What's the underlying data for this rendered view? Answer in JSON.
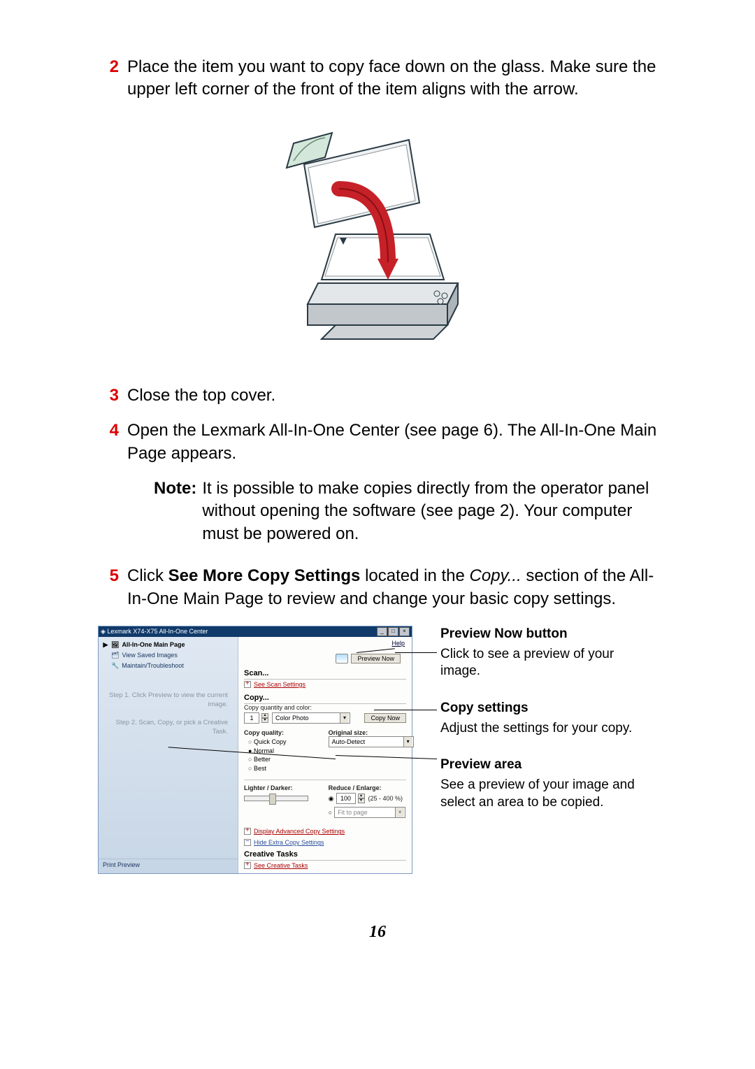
{
  "steps": {
    "s2": {
      "num": "2",
      "text": "Place the item you want to copy face down on the glass. Make sure the upper left corner of the front of the item aligns with the arrow."
    },
    "s3": {
      "num": "3",
      "text": "Close the top cover."
    },
    "s4": {
      "num": "4",
      "text": "Open the Lexmark All-In-One Center (see page 6). The All-In-One Main Page appears."
    },
    "s5": {
      "num": "5",
      "pre": "Click ",
      "bold": "See More Copy Settings",
      "mid": " located in the ",
      "italic": "Copy...",
      "post": " section of the All-In-One Main Page to review and change your basic copy settings."
    }
  },
  "note": {
    "label": "Note:",
    "text": "It is possible to make copies directly from the operator panel without opening the software (see page 2). Your computer must be powered on."
  },
  "callouts": {
    "preview_now": {
      "title": "Preview Now button",
      "text": "Click to see a preview of your image."
    },
    "copy_settings": {
      "title": "Copy settings",
      "text": "Adjust the settings for your copy."
    },
    "preview_area": {
      "title": "Preview area",
      "text": "See a preview of your image and select an area to be copied."
    }
  },
  "window": {
    "title": "Lexmark X74-X75 All-In-One Center",
    "help": "Help",
    "sidebar": {
      "main_page": "All-In-One Main Page",
      "saved": "View Saved Images",
      "maintain": "Maintain/Troubleshoot",
      "step1": "Step 1.  Click Preview to view the current image.",
      "step2": "Step 2.  Scan, Copy, or pick a Creative Task.",
      "footer": "Print Preview"
    },
    "preview_now_btn": "Preview Now",
    "scan": {
      "title": "Scan...",
      "link": "See Scan Settings"
    },
    "copy": {
      "title": "Copy...",
      "sub": "Copy quantity and color:",
      "qty": "1",
      "type": "Color Photo",
      "copy_now_btn": "Copy Now",
      "quality_label": "Copy quality:",
      "quality_opts": [
        "Quick Copy",
        "Normal",
        "Better",
        "Best"
      ],
      "quality_selected": "Normal",
      "origsize_label": "Original size:",
      "origsize_value": "Auto-Detect",
      "lighter_label": "Lighter / Darker:",
      "reduce_label": "Reduce / Enlarge:",
      "reduce_value": "100",
      "reduce_range": "(25 - 400 %)",
      "fit_label": "Fit to page",
      "adv_link": "Display Advanced Copy Settings",
      "hide_link": "Hide Extra Copy Settings"
    },
    "creative": {
      "title": "Creative Tasks",
      "link": "See Creative Tasks"
    }
  },
  "page_number": "16"
}
